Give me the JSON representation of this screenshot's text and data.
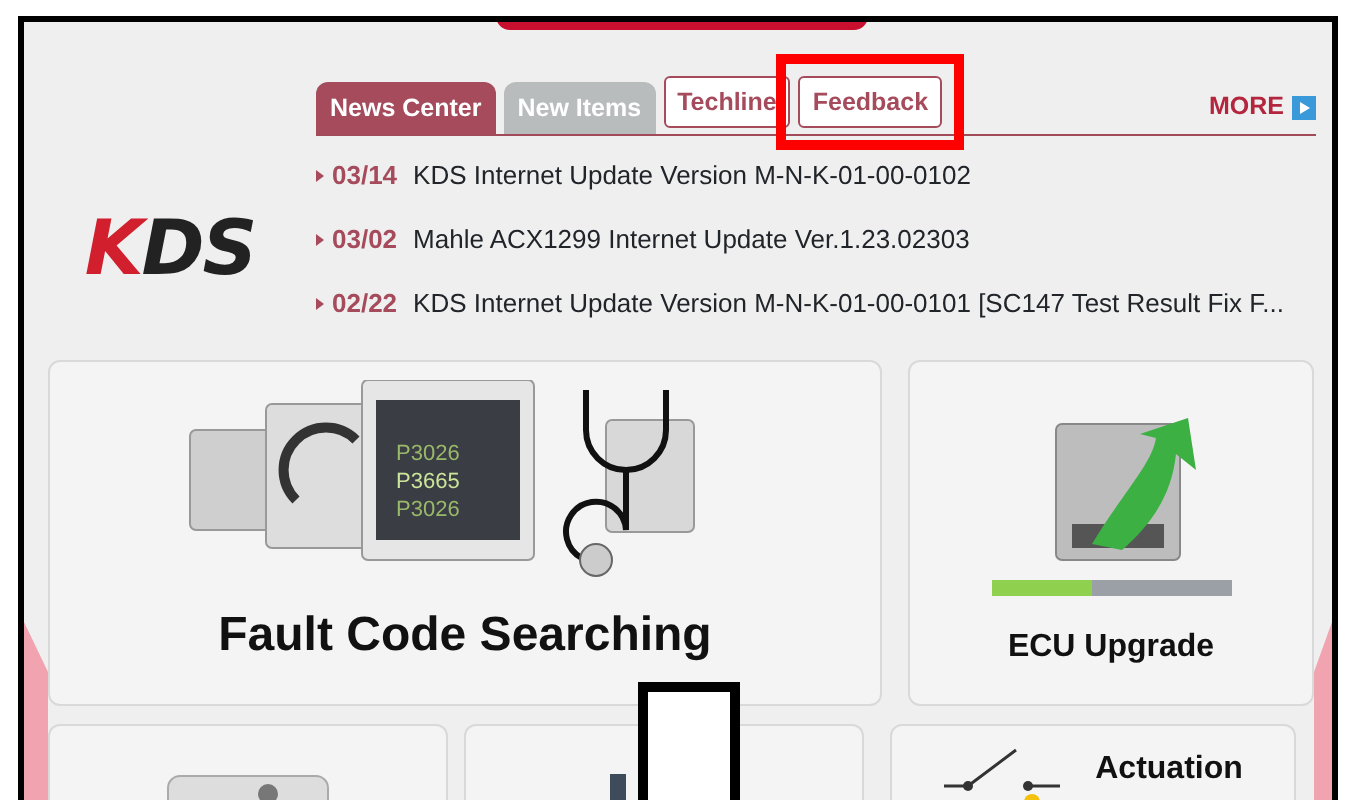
{
  "tabs": [
    {
      "label": "News Center",
      "kind": "filled",
      "selected": true,
      "highlighted": false
    },
    {
      "label": "New Items",
      "kind": "filled",
      "selected": false,
      "highlighted": false
    },
    {
      "label": "Techline",
      "kind": "outline",
      "selected": false,
      "highlighted": false
    },
    {
      "label": "Feedback",
      "kind": "outline",
      "selected": false,
      "highlighted": true
    }
  ],
  "more_link": "MORE",
  "logo": "KDS",
  "news": [
    {
      "date": "03/14",
      "title": "KDS Internet Update Version M-N-K-01-00-0102"
    },
    {
      "date": "03/02",
      "title": "Mahle ACX1299 Internet Update Ver.1.23.02303"
    },
    {
      "date": "02/22",
      "title": "KDS Internet Update Version M-N-K-01-00-0101 [SC147 Test Result Fix F..."
    }
  ],
  "tiles": [
    {
      "kind": "fault",
      "label": "Fault Code Searching",
      "codes": [
        "P3026",
        "P3665",
        "P3026"
      ]
    },
    {
      "kind": "ecu",
      "label": "ECU Upgrade",
      "level": 0.42
    },
    {
      "kind": "part"
    },
    {
      "kind": "dark"
    },
    {
      "kind": "switch",
      "label": "Actuation"
    }
  ],
  "cover_box": true
}
